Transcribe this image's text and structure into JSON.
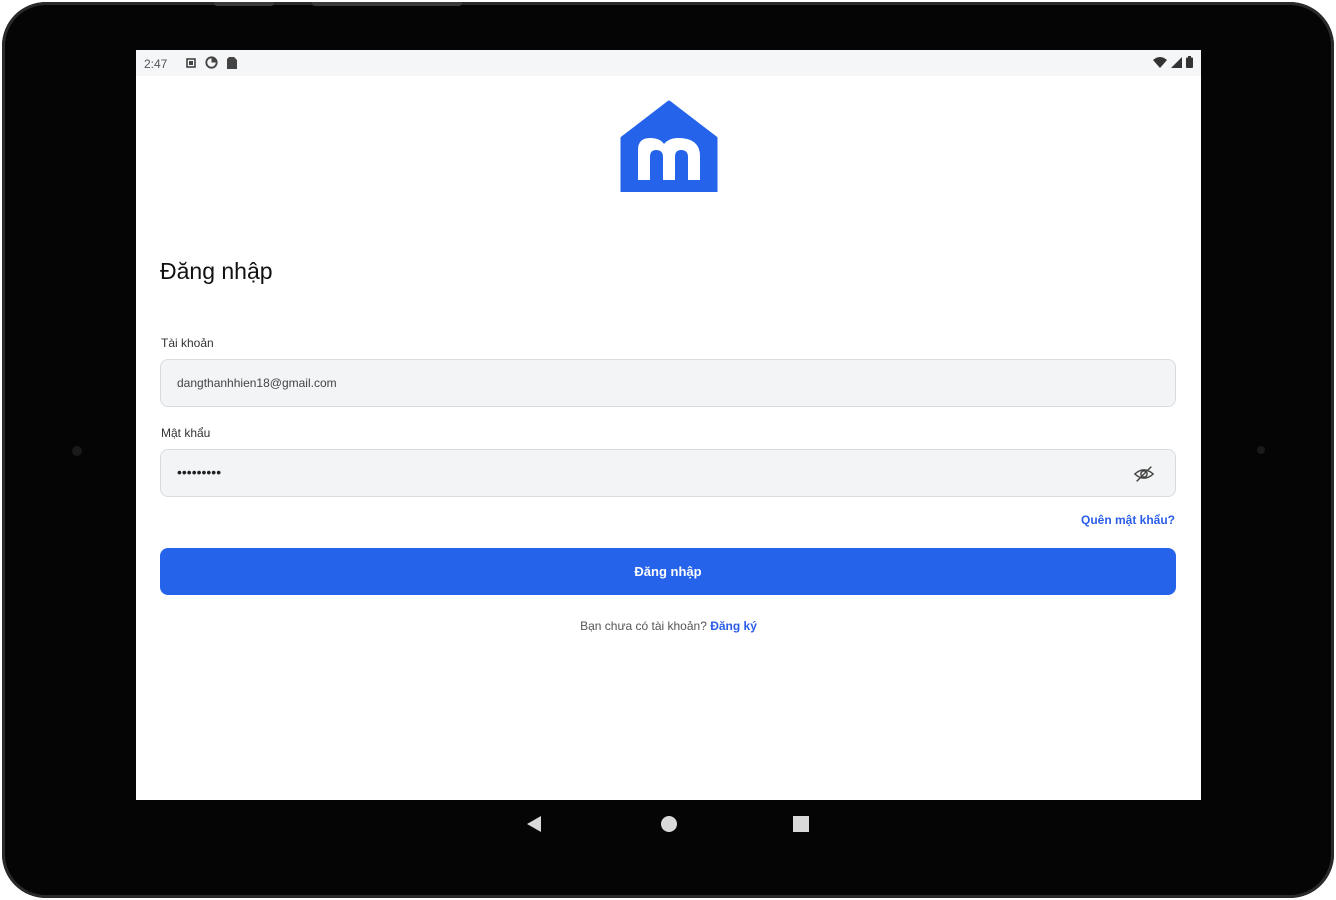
{
  "status_bar": {
    "time": "2:47"
  },
  "login": {
    "title": "Đăng nhập",
    "account_label": "Tài khoản",
    "account_value": "dangthanhhien18@gmail.com",
    "password_label": "Mật khẩu",
    "password_masked": "•••••••••",
    "forgot_link": "Quên mật khẩu?",
    "submit_label": "Đăng nhập",
    "no_account_text": "Bạn chưa có tài khoản?",
    "signup_link": "Đăng ký"
  },
  "colors": {
    "accent": "#2563eb",
    "link": "#2b5de8",
    "field_bg": "#f3f4f5"
  },
  "icons": {
    "logo": "house-m-logo",
    "password_toggle": "eye-off-icon",
    "nav_back": "triangle-back-icon",
    "nav_home": "circle-home-icon",
    "nav_recents": "square-recents-icon"
  }
}
